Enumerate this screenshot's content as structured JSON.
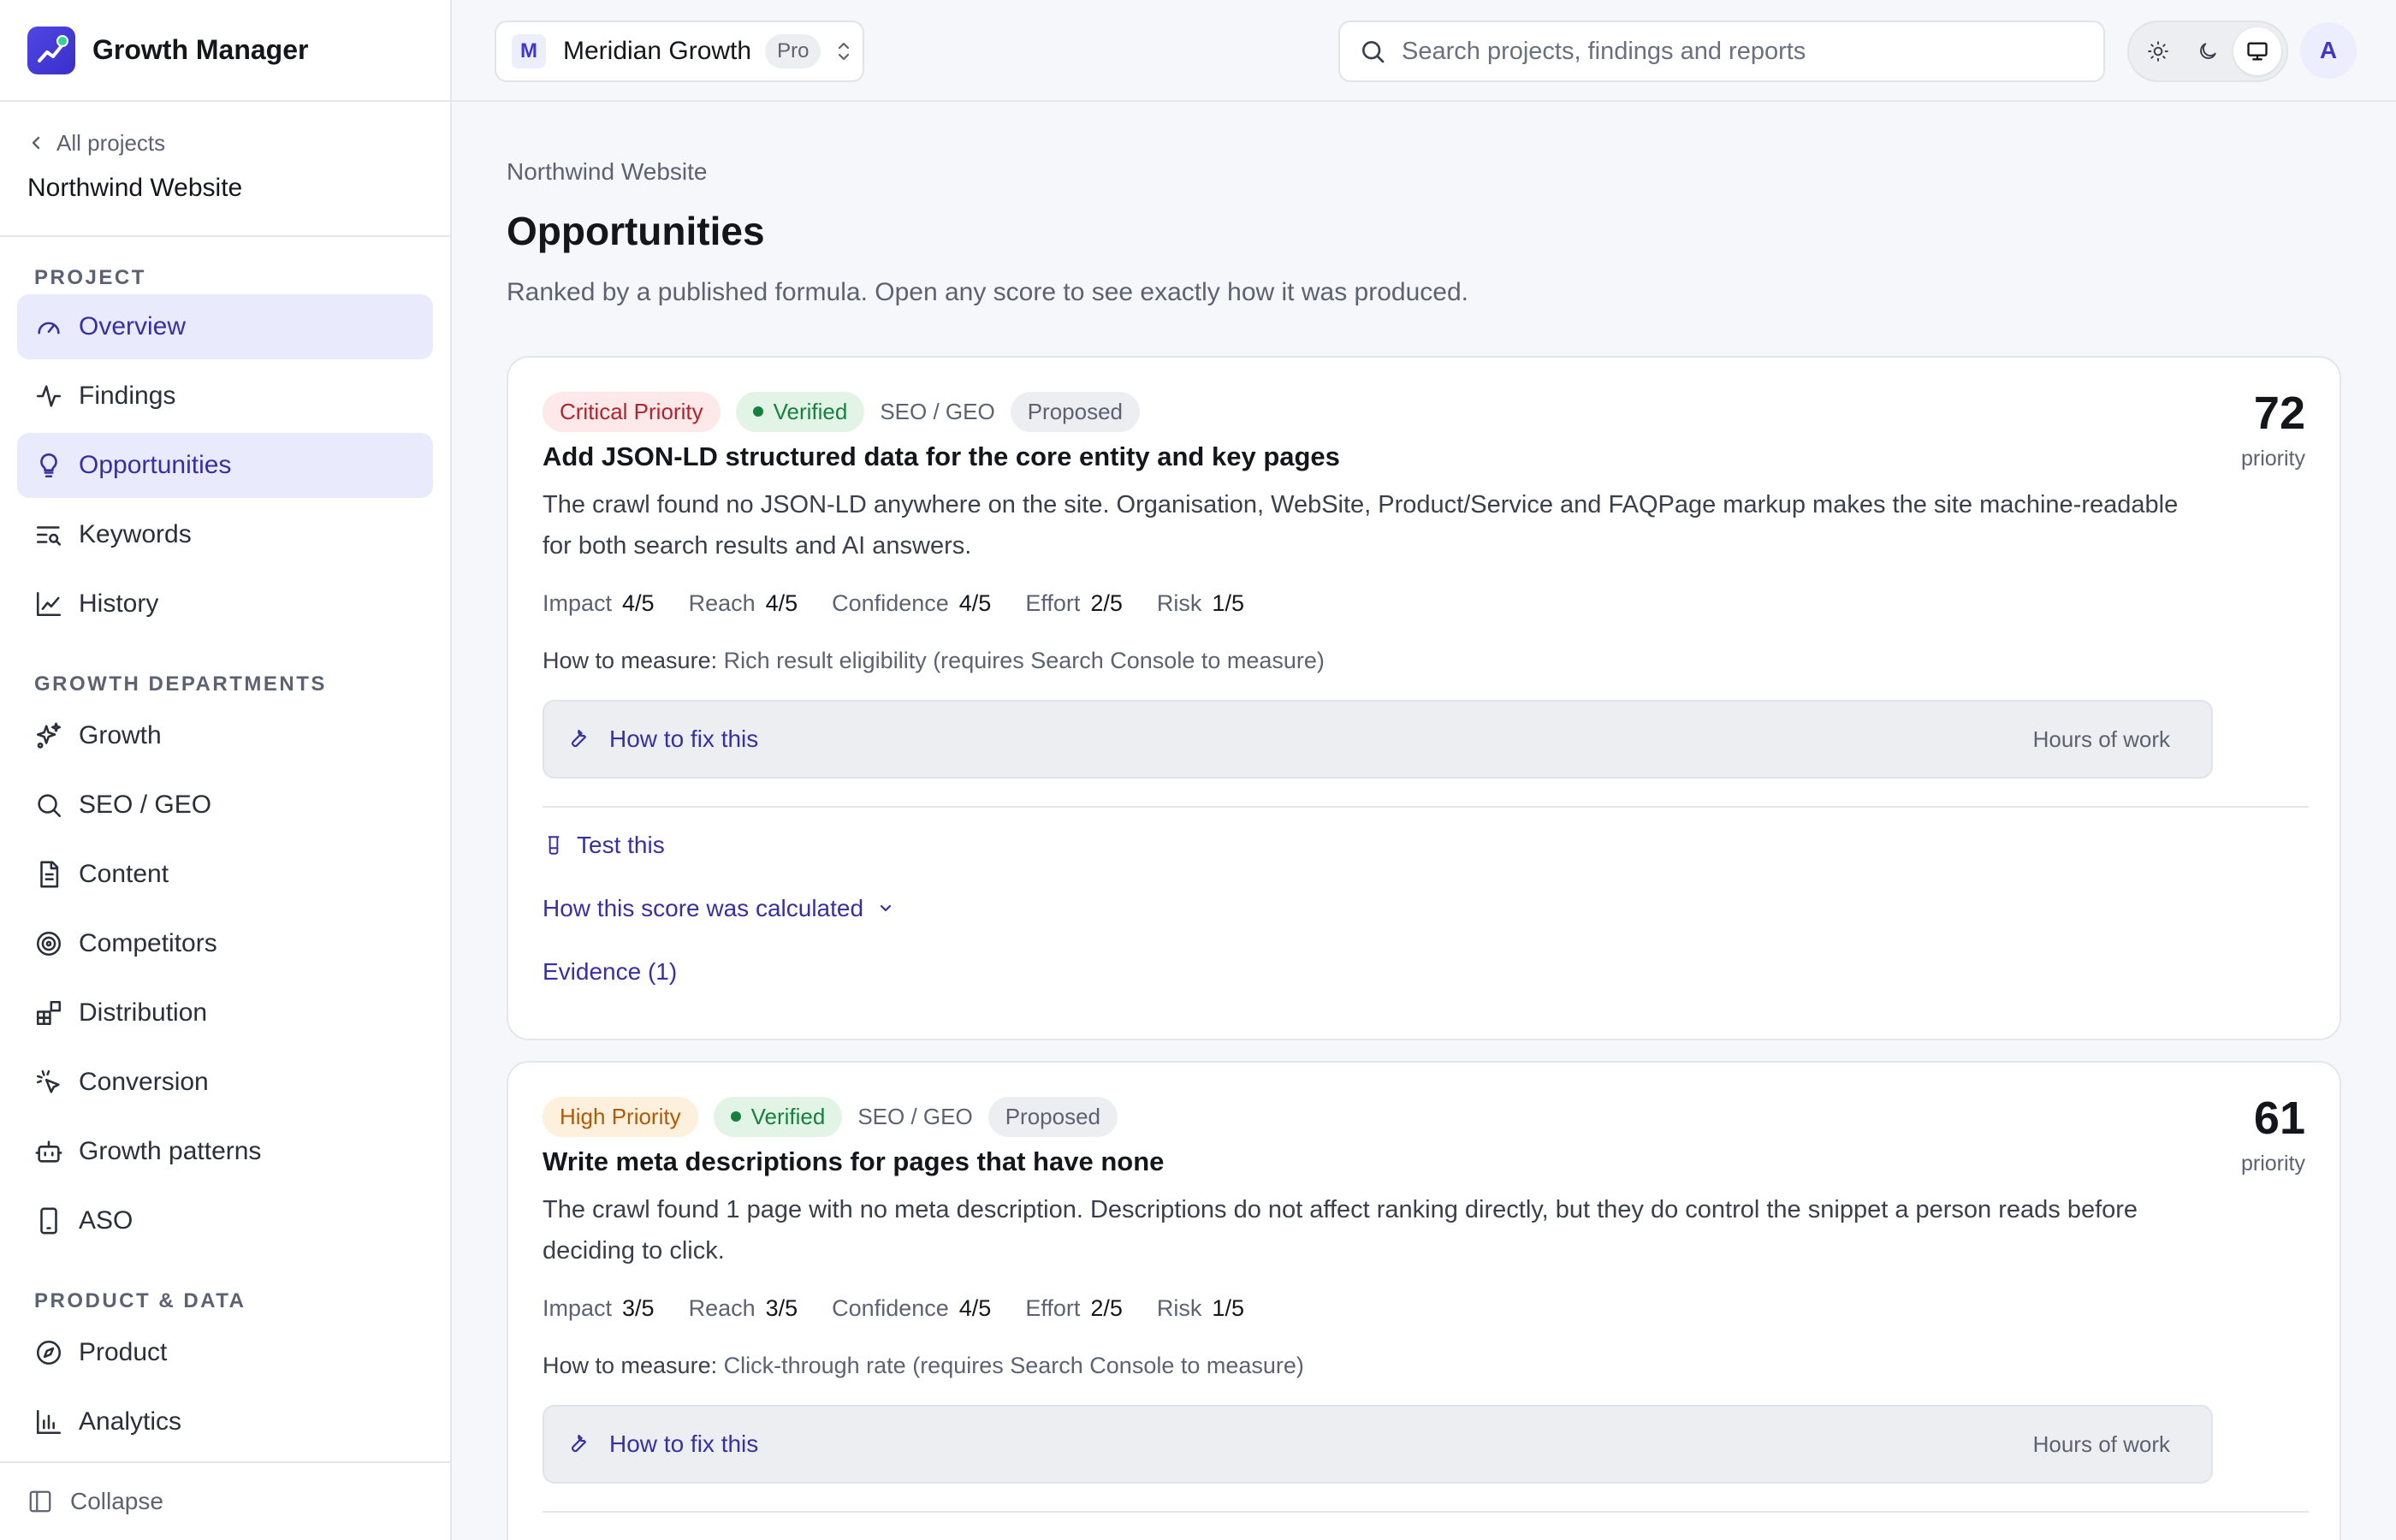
{
  "app": {
    "name": "Growth Manager"
  },
  "sidebar": {
    "back_label": "All projects",
    "project_name": "Northwind Website",
    "sections": [
      {
        "heading": "PROJECT",
        "items": [
          "Overview",
          "Findings",
          "Opportunities",
          "Keywords",
          "History"
        ]
      },
      {
        "heading": "GROWTH DEPARTMENTS",
        "items": [
          "Growth",
          "SEO / GEO",
          "Content",
          "Competitors",
          "Distribution",
          "Conversion",
          "Growth patterns",
          "ASO"
        ]
      },
      {
        "heading": "PRODUCT & DATA",
        "items": [
          "Product",
          "Analytics"
        ]
      }
    ],
    "collapse_label": "Collapse"
  },
  "topbar": {
    "workspace_initial": "M",
    "workspace_name": "Meridian Growth",
    "workspace_plan": "Pro",
    "search_placeholder": "Search projects, findings and reports",
    "avatar_initial": "A"
  },
  "main": {
    "breadcrumb": "Northwind Website",
    "title": "Opportunities",
    "subtitle": "Ranked by a published formula. Open any score to see exactly how it was produced."
  },
  "opportunities": [
    {
      "priority_tag": "Critical Priority",
      "verified_tag": "Verified",
      "department": "SEO / GEO",
      "status": "Proposed",
      "title": "Add JSON-LD structured data for the core entity and key pages",
      "description": "The crawl found no JSON-LD anywhere on the site. Organisation, WebSite, Product/Service and FAQPage markup makes the site machine-readable for both search results and AI answers.",
      "scores": {
        "impact": "4/5",
        "reach": "4/5",
        "confidence": "4/5",
        "effort": "2/5",
        "risk": "1/5"
      },
      "measure_label": "How to measure:",
      "measure_value": "Rich result eligibility (requires Search Console to measure)",
      "fix_label": "How to fix this",
      "hours_label": "Hours of work",
      "test_label": "Test this",
      "calc_label": "How this score was calculated",
      "evidence_label": "Evidence (1)",
      "score": "72",
      "score_caption": "priority"
    },
    {
      "priority_tag": "High Priority",
      "verified_tag": "Verified",
      "department": "SEO / GEO",
      "status": "Proposed",
      "title": "Write meta descriptions for pages that have none",
      "description": "The crawl found 1 page with no meta description. Descriptions do not affect ranking directly, but they do control the snippet a person reads before deciding to click.",
      "scores": {
        "impact": "3/5",
        "reach": "3/5",
        "confidence": "4/5",
        "effort": "2/5",
        "risk": "1/5"
      },
      "measure_label": "How to measure:",
      "measure_value": "Click-through rate (requires Search Console to measure)",
      "fix_label": "How to fix this",
      "hours_label": "Hours of work",
      "score": "61",
      "score_caption": "priority"
    }
  ],
  "score_labels": {
    "impact": "Impact",
    "reach": "Reach",
    "confidence": "Confidence",
    "effort": "Effort",
    "risk": "Risk"
  },
  "colors": {
    "accent": "#3730a3",
    "critical": "#b4232b",
    "high": "#b0590a",
    "verified": "#17803d"
  }
}
